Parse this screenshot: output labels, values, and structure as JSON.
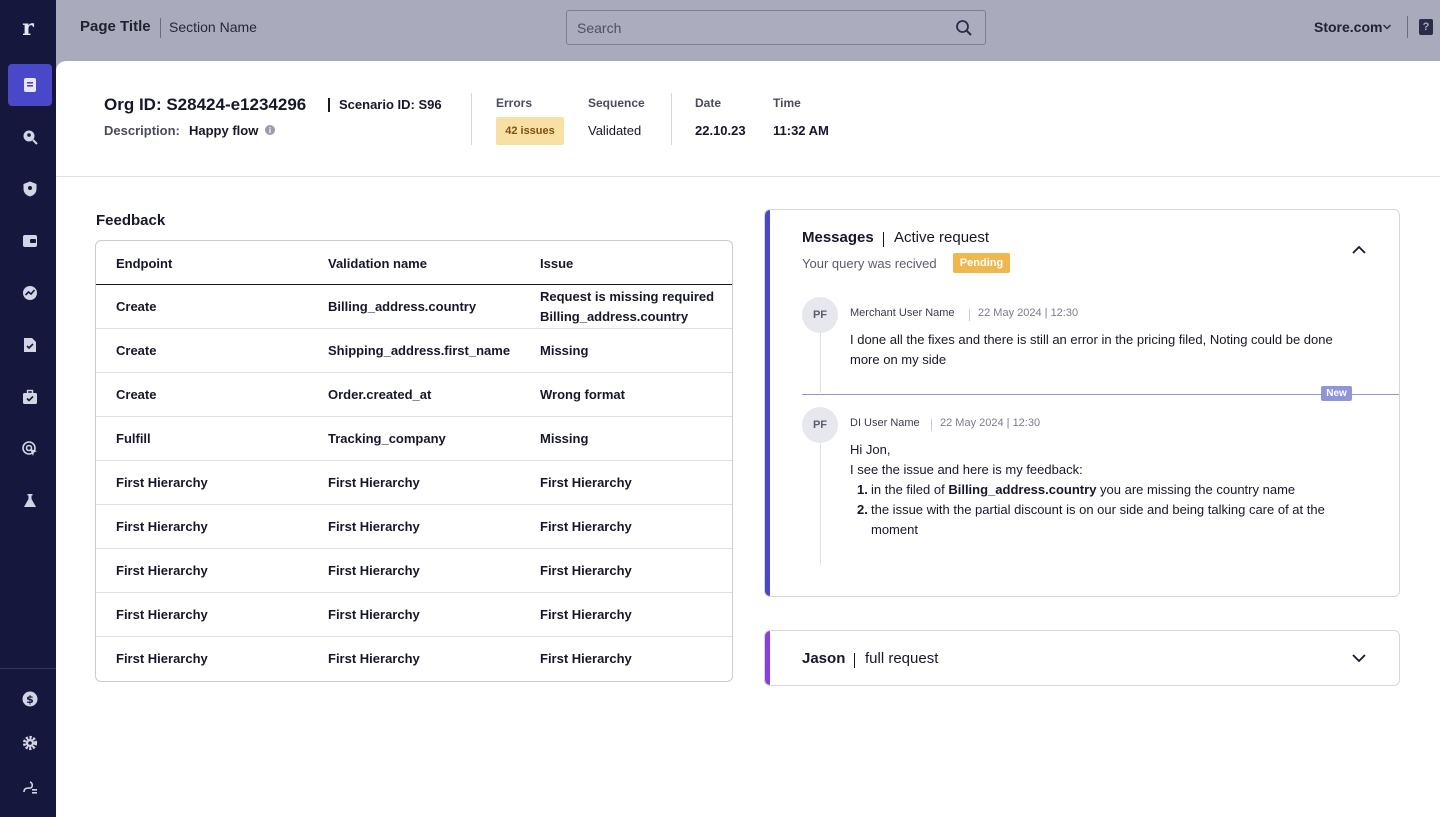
{
  "app": {
    "logo_text": "r"
  },
  "sidebar": {
    "items": [
      {
        "icon": "document-icon",
        "active": true
      },
      {
        "icon": "search-user-icon",
        "active": false
      },
      {
        "icon": "shield-icon",
        "active": false
      },
      {
        "icon": "wallet-icon",
        "active": false
      },
      {
        "icon": "chart-circle-icon",
        "active": false
      },
      {
        "icon": "file-check-icon",
        "active": false
      },
      {
        "icon": "briefcase-check-icon",
        "active": false
      },
      {
        "icon": "cursor-target-icon",
        "active": false
      },
      {
        "icon": "flask-icon",
        "active": false
      }
    ],
    "bottom_items": [
      {
        "icon": "dollar-icon"
      },
      {
        "icon": "gear-icon"
      },
      {
        "icon": "integration-icon"
      }
    ]
  },
  "topbar": {
    "page_title": "Page Title",
    "section_name": "Section Name",
    "search_placeholder": "Search",
    "store": "Store.com",
    "help": "?"
  },
  "header": {
    "org_id": "Org ID: S28424-e1234296",
    "scenario_id": "Scenario ID: S96",
    "description_label": "Description:",
    "description_value": "Happy flow",
    "errors_label": "Errors",
    "errors_badge": "42 issues",
    "sequence_label": "Sequence",
    "sequence_value": "Validated",
    "date_label": "Date",
    "date_value": "22.10.23",
    "time_label": "Time",
    "time_value": "11:32 AM"
  },
  "feedback": {
    "title": "Feedback",
    "columns": [
      "Endpoint",
      "Validation name",
      "Issue"
    ],
    "rows": [
      [
        "Create",
        "Billing_address.country",
        "Request is missing required Billing_address.country"
      ],
      [
        "Create",
        "Shipping_address.first_name",
        "Missing"
      ],
      [
        "Create",
        "Order.created_at",
        "Wrong format"
      ],
      [
        "Fulfill",
        "Tracking_company",
        "Missing"
      ],
      [
        "First Hierarchy",
        "First Hierarchy",
        "First Hierarchy"
      ],
      [
        "First Hierarchy",
        "First Hierarchy",
        "First Hierarchy"
      ],
      [
        "First Hierarchy",
        "First Hierarchy",
        "First Hierarchy"
      ],
      [
        "First Hierarchy",
        "First Hierarchy",
        "First Hierarchy"
      ],
      [
        "First Hierarchy",
        "First Hierarchy",
        "First Hierarchy"
      ]
    ]
  },
  "messages": {
    "title": "Messages",
    "subtitle": "Active request",
    "query_status": "Your query was recived",
    "status_badge": "Pending",
    "new_tag": "New",
    "thread": [
      {
        "initials": "PF",
        "author": "Merchant User Name",
        "time": "22 May 2024 | 12:30",
        "text": "I done all the fixes and there is still an error in the pricing filed, Noting could be done more on my side"
      },
      {
        "initials": "PF",
        "author": "DI User Name",
        "time": "22 May 2024 | 12:30",
        "greeting": "Hi Jon,",
        "intro": "I see the issue and here is my feedback:",
        "list": [
          {
            "num": "1.",
            "before": "in the filed of ",
            "bold": "Billing_address.country",
            "after": " you are missing the country name"
          },
          {
            "num": "2.",
            "before": "the issue with the partial discount is on our side and being talking care of at the moment",
            "bold": "",
            "after": ""
          }
        ]
      }
    ]
  },
  "jason": {
    "title": "Jason",
    "subtitle": "full request"
  },
  "colors": {
    "sidebar_bg": "#15173d",
    "accent": "#4b47c9",
    "secondary_accent": "#8b3fe0",
    "pending": "#efb84e",
    "issues_badge_bg": "#f8dfa4",
    "overlay": "#a9abbd"
  }
}
